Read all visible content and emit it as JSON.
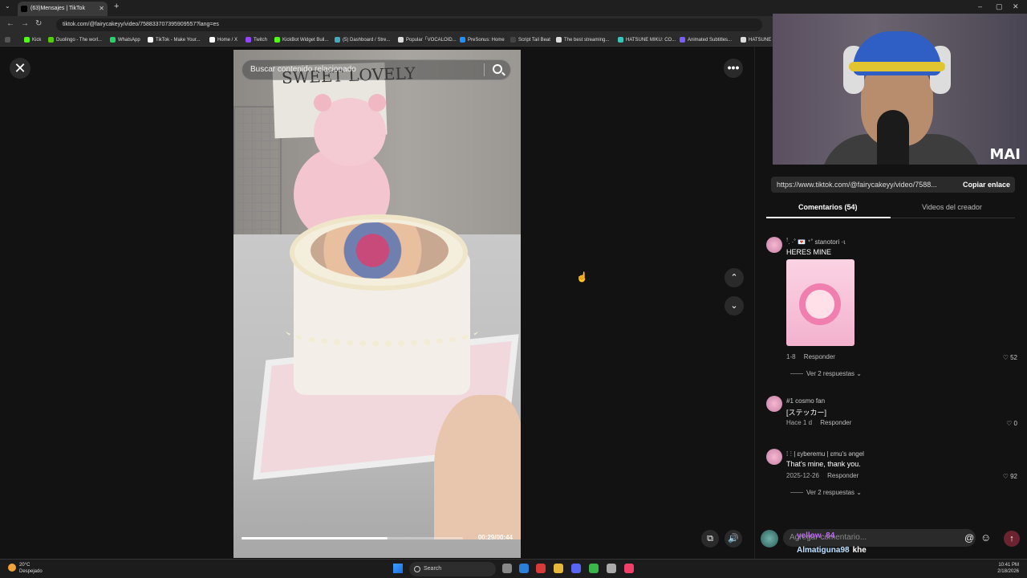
{
  "browser": {
    "tab_title": "(63)Mensajes | TikTok",
    "url": "tiktok.com/@fairycakeyy/video/758833707395909557?lang=es",
    "bookmarks": [
      {
        "label": "Kick",
        "color": "#53fc18"
      },
      {
        "label": "Duolingo - The worl...",
        "color": "#58cc02"
      },
      {
        "label": "WhatsApp",
        "color": "#25d366"
      },
      {
        "label": "TikTok - Make Your...",
        "color": "#ffffff"
      },
      {
        "label": "Home / X",
        "color": "#ffffff"
      },
      {
        "label": "Twitch",
        "color": "#9146ff"
      },
      {
        "label": "KickBot Widget Buil...",
        "color": "#53fc18"
      },
      {
        "label": "(5) Dashboard / Stre...",
        "color": "#4ab"
      },
      {
        "label": "Popular「VOCALOID...",
        "color": "#ddd"
      },
      {
        "label": "PreSonus: Home",
        "color": "#1e90ff"
      },
      {
        "label": "Script Tail Beat",
        "color": "#444"
      },
      {
        "label": "The best streaming...",
        "color": "#ddd"
      },
      {
        "label": "HATSUNE MIKU: CO...",
        "color": "#39c5bb"
      },
      {
        "label": "Animated Subtitles...",
        "color": "#7b5cff"
      },
      {
        "label": "HATSUNE",
        "color": "#ddd"
      }
    ]
  },
  "video": {
    "search_placeholder": "Buscar contenido relacionado",
    "poster_text": "SWEET LOVELY",
    "timecode": "00:29/00:44",
    "progress": 0.66
  },
  "webcam": {
    "logo": "MAI"
  },
  "panel": {
    "link": "https://www.tiktok.com/@fairycakeyy/video/7588...",
    "copy_label": "Copiar enlace",
    "tab_comments": "Comentarios (54)",
    "tab_creator": "Videos del creador"
  },
  "comments": [
    {
      "user": "ꜝ. ·˚ 💌 ⁺˚  stanotori ·ꙇ",
      "text": "HERES MINE",
      "date": "1-8",
      "reply": "Responder",
      "likes": "52",
      "replies": "Ver 2 respuestas"
    },
    {
      "user": "#1 cosmo fan",
      "text": "[ステッカー]",
      "date": "Hace 1 d",
      "reply": "Responder",
      "likes": "0"
    },
    {
      "user": "⁞ ⵗ  | ɛyberemu  | ɛmu's ǝngel",
      "text": "That's mine, thank you.",
      "date": "2025-12-26",
      "reply": "Responder",
      "likes": "92",
      "replies": "Ver 2 respuestas"
    }
  ],
  "composer": {
    "placeholder": "Agregar comentario...",
    "at_icon": "@",
    "chat_user_overlay": "yellow_84",
    "chat_name": "Almatiguna98",
    "chat_msg": "khe"
  },
  "taskbar": {
    "temp": "20°C",
    "weather": "Despejado",
    "search": "Search",
    "time": "10:41 PM",
    "date": "2/18/2026"
  },
  "colors": {
    "accent": "#fe2c55",
    "panel_bg": "#121212"
  }
}
